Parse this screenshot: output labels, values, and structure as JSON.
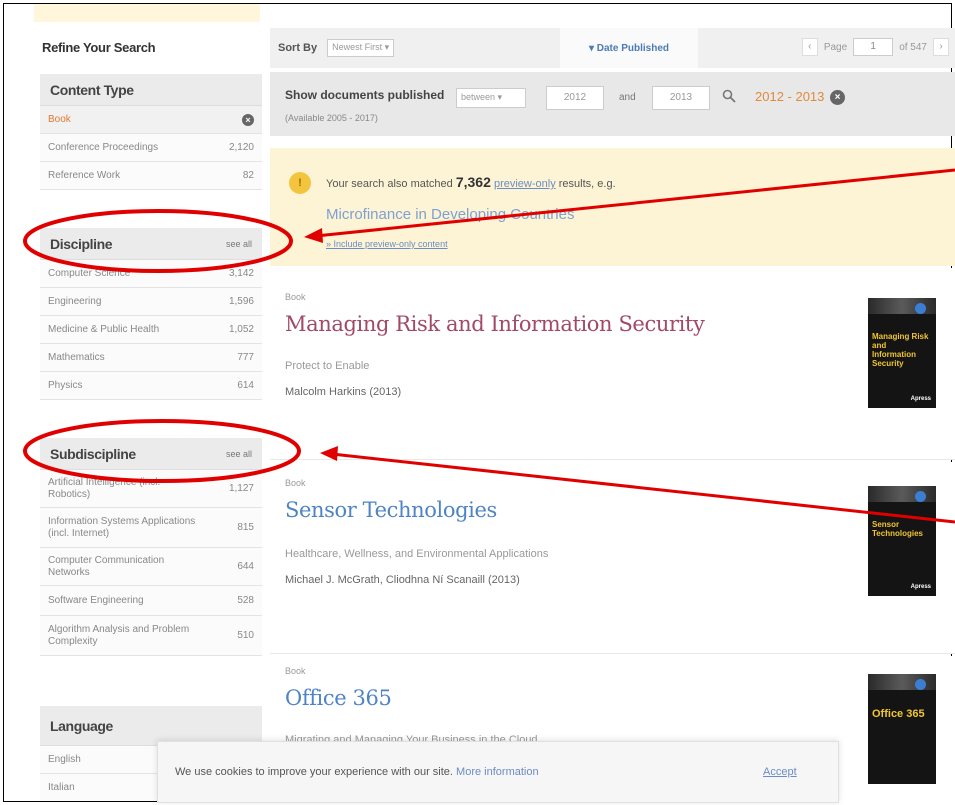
{
  "sidebar": {
    "title": "Refine Your Search",
    "content_type": {
      "title": "Content Type",
      "items": [
        {
          "label": "Book",
          "count": ""
        },
        {
          "label": "Conference Proceedings",
          "count": "2,120"
        },
        {
          "label": "Reference Work",
          "count": "82"
        }
      ]
    },
    "discipline": {
      "title": "Discipline",
      "see_all": "see all",
      "items": [
        {
          "label": "Computer Science",
          "count": "3,142"
        },
        {
          "label": "Engineering",
          "count": "1,596"
        },
        {
          "label": "Medicine & Public Health",
          "count": "1,052"
        },
        {
          "label": "Mathematics",
          "count": "777"
        },
        {
          "label": "Physics",
          "count": "614"
        }
      ]
    },
    "subdiscipline": {
      "title": "Subdiscipline",
      "see_all": "see all",
      "items": [
        {
          "label": "Artificial Intelligence (incl. Robotics)",
          "count": "1,127"
        },
        {
          "label": "Information Systems Applications (incl. Internet)",
          "count": "815"
        },
        {
          "label": "Computer Communication Networks",
          "count": "644"
        },
        {
          "label": "Software Engineering",
          "count": "528"
        },
        {
          "label": "Algorithm Analysis and Problem Complexity",
          "count": "510"
        }
      ]
    },
    "language": {
      "title": "Language",
      "items": [
        {
          "label": "English",
          "count": ""
        },
        {
          "label": "Italian",
          "count": ""
        }
      ]
    }
  },
  "toolbar": {
    "sort_by_label": "Sort By",
    "sort_value": "Newest First ▾",
    "date_tab": "▾ Date Published",
    "page_label": "Page",
    "page_value": "1",
    "page_total": "of 547",
    "prev": "‹",
    "next": "›"
  },
  "date_filter": {
    "label": "Show documents published",
    "mode": "between ▾",
    "from": "2012",
    "and": "and",
    "to": "2013",
    "available": "(Available 2005 - 2017)",
    "range": "2012 - 2013",
    "clear": "×"
  },
  "notice": {
    "icon": "!",
    "prefix": "Your search also matched",
    "count": "7,362",
    "link": "preview-only",
    "suffix": "results, e.g.",
    "title": "Microfinance in Developing Countries",
    "include": "» Include preview-only content"
  },
  "results": [
    {
      "type": "Book",
      "title": "Managing Risk and Information Security",
      "subtitle": "Protect to Enable",
      "authors": "Malcolm Harkins (2013)",
      "cover_text": "Managing Risk and Information Security",
      "title_color": "#a14a67"
    },
    {
      "type": "Book",
      "title": "Sensor Technologies",
      "subtitle": "Healthcare, Wellness, and Environmental Applications",
      "authors": "Michael J. McGrath, Cliodhna Ní Scanaill (2013)",
      "cover_text": "Sensor Technologies",
      "title_color": "#4f84c4"
    },
    {
      "type": "Book",
      "title": "Office 365",
      "subtitle": "Migrating and Managing Your Business in the Cloud",
      "authors": "",
      "cover_text": "Office 365",
      "title_color": "#4f84c4"
    }
  ],
  "cookie": {
    "text": "We use cookies to improve your experience with our site.",
    "link": "More information",
    "accept": "Accept"
  },
  "colors": {
    "accent": "#e07a2e",
    "link": "#6b8cc4",
    "annotation": "#e00000"
  }
}
